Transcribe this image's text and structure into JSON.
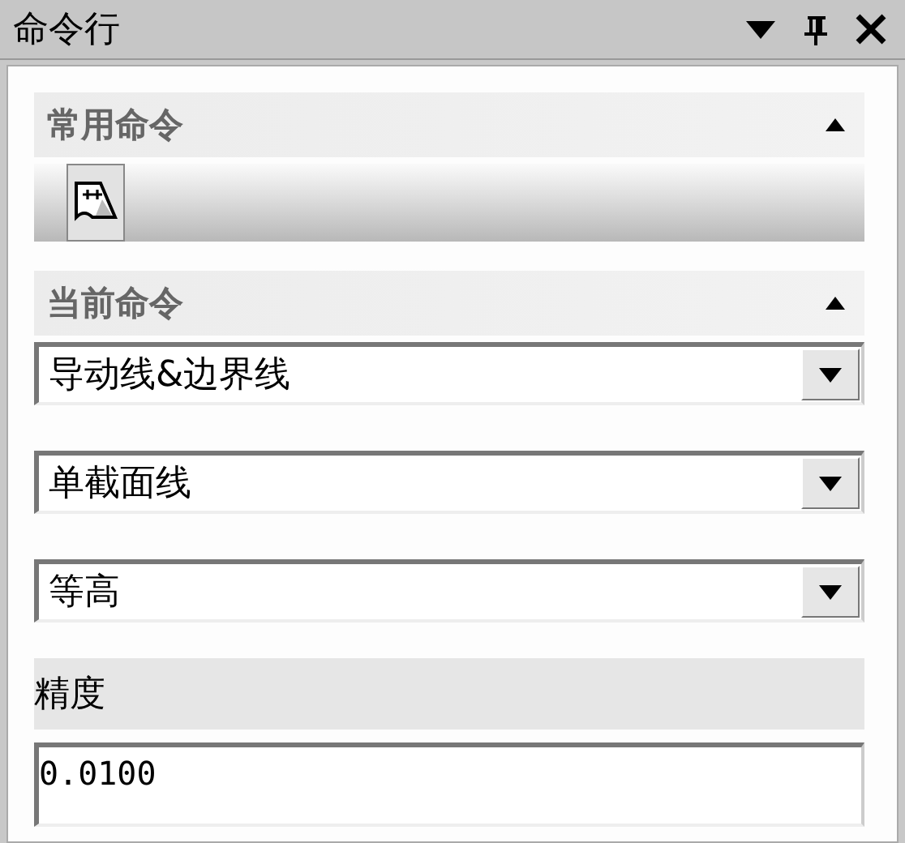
{
  "window": {
    "title": "命令行"
  },
  "sections": [
    {
      "title": "常用命令",
      "expanded": true
    },
    {
      "title": "当前命令",
      "expanded": true
    }
  ],
  "toolbar": {
    "buttons": [
      {
        "kind": "curve",
        "selected": true
      }
    ]
  },
  "dropdowns": [
    {
      "value": "导动线&边界线"
    },
    {
      "value": "单截面线"
    },
    {
      "value": "等高"
    }
  ],
  "precision": {
    "label": "精度",
    "value": "0.0100"
  }
}
